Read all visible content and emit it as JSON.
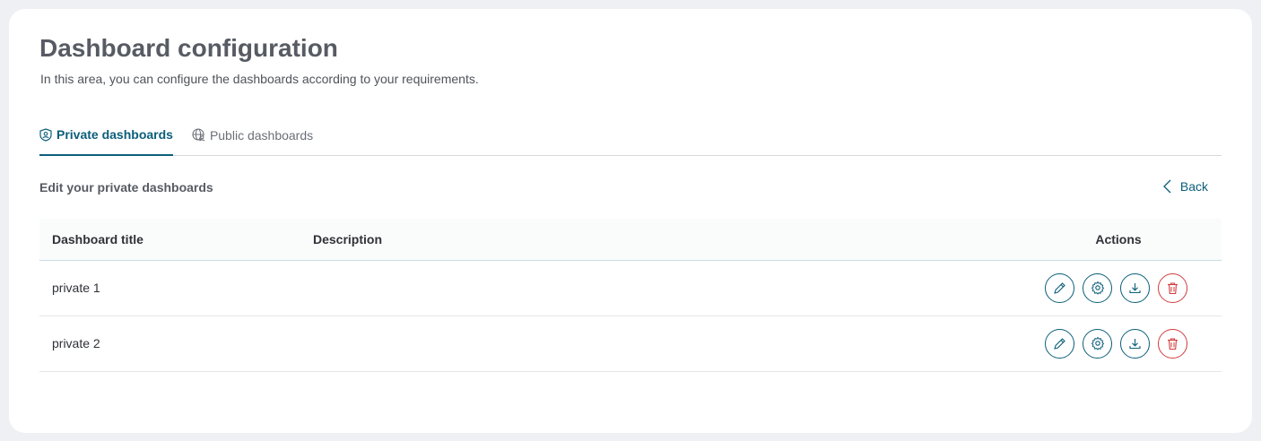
{
  "page": {
    "title": "Dashboard configuration",
    "subtitle": "In this area, you can configure the dashboards according to your requirements."
  },
  "tabs": [
    {
      "label": "Private dashboards",
      "icon": "shield-user-icon",
      "active": true
    },
    {
      "label": "Public dashboards",
      "icon": "globe-user-icon",
      "active": false
    }
  ],
  "section": {
    "title": "Edit your private dashboards",
    "back_label": "Back"
  },
  "table": {
    "columns": [
      "Dashboard title",
      "Description",
      "Actions"
    ],
    "rows": [
      {
        "title": "private 1",
        "description": ""
      },
      {
        "title": "private 2",
        "description": ""
      }
    ],
    "actions": [
      "pencil-icon",
      "gear-icon",
      "download-icon",
      "trash-icon"
    ]
  },
  "colors": {
    "accent": "#0b5e7a",
    "danger": "#d13c3c"
  }
}
